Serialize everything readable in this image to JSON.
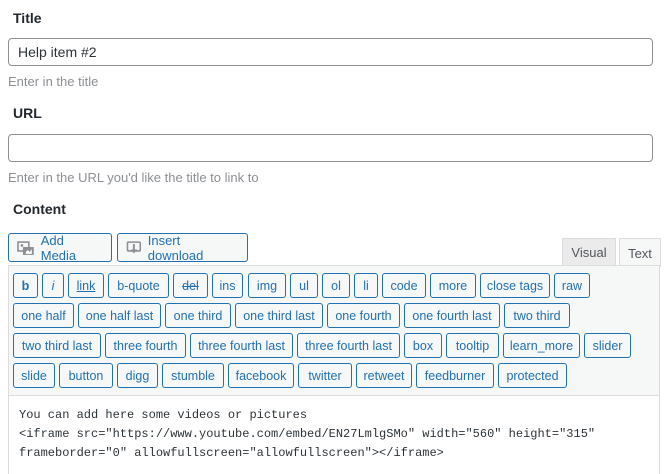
{
  "title_field": {
    "label": "Title",
    "value": "Help item #2",
    "hint": "Enter in the title"
  },
  "url_field": {
    "label": "URL",
    "value": "",
    "hint": "Enter in the URL you'd like the title to link to"
  },
  "content": {
    "label": "Content",
    "add_media": "Add Media",
    "insert_download": "Insert download",
    "tabs": {
      "visual": "Visual",
      "text": "Text"
    },
    "active_tab": "Text",
    "quicktags": [
      "b",
      "i",
      "link",
      "b-quote",
      "del",
      "ins",
      "img",
      "ul",
      "ol",
      "li",
      "code",
      "more",
      "close tags",
      "raw",
      "one half",
      "one half last",
      "one third",
      "one third last",
      "one fourth",
      "one fourth last",
      "two third",
      "two third last",
      "three fourth",
      "three fourth last",
      "three fourth last",
      "box",
      "tooltip",
      "learn_more",
      "slider",
      "slide",
      "button",
      "digg",
      "stumble",
      "facebook",
      "twitter",
      "retweet",
      "feedburner",
      "protected"
    ],
    "body_lines": [
      "You can add here some videos or pictures",
      "<iframe src=\"https://www.youtube.com/embed/EN27LmlgSMo\" width=\"560\" height=\"315\"",
      "frameborder=\"0\" allowfullscreen=\"allowfullscreen\"></iframe>"
    ]
  },
  "colors": {
    "accent": "#2271b1",
    "hint": "#8c8f94",
    "toolbar_bg": "#f6f7f7",
    "border": "#dcdcde"
  }
}
